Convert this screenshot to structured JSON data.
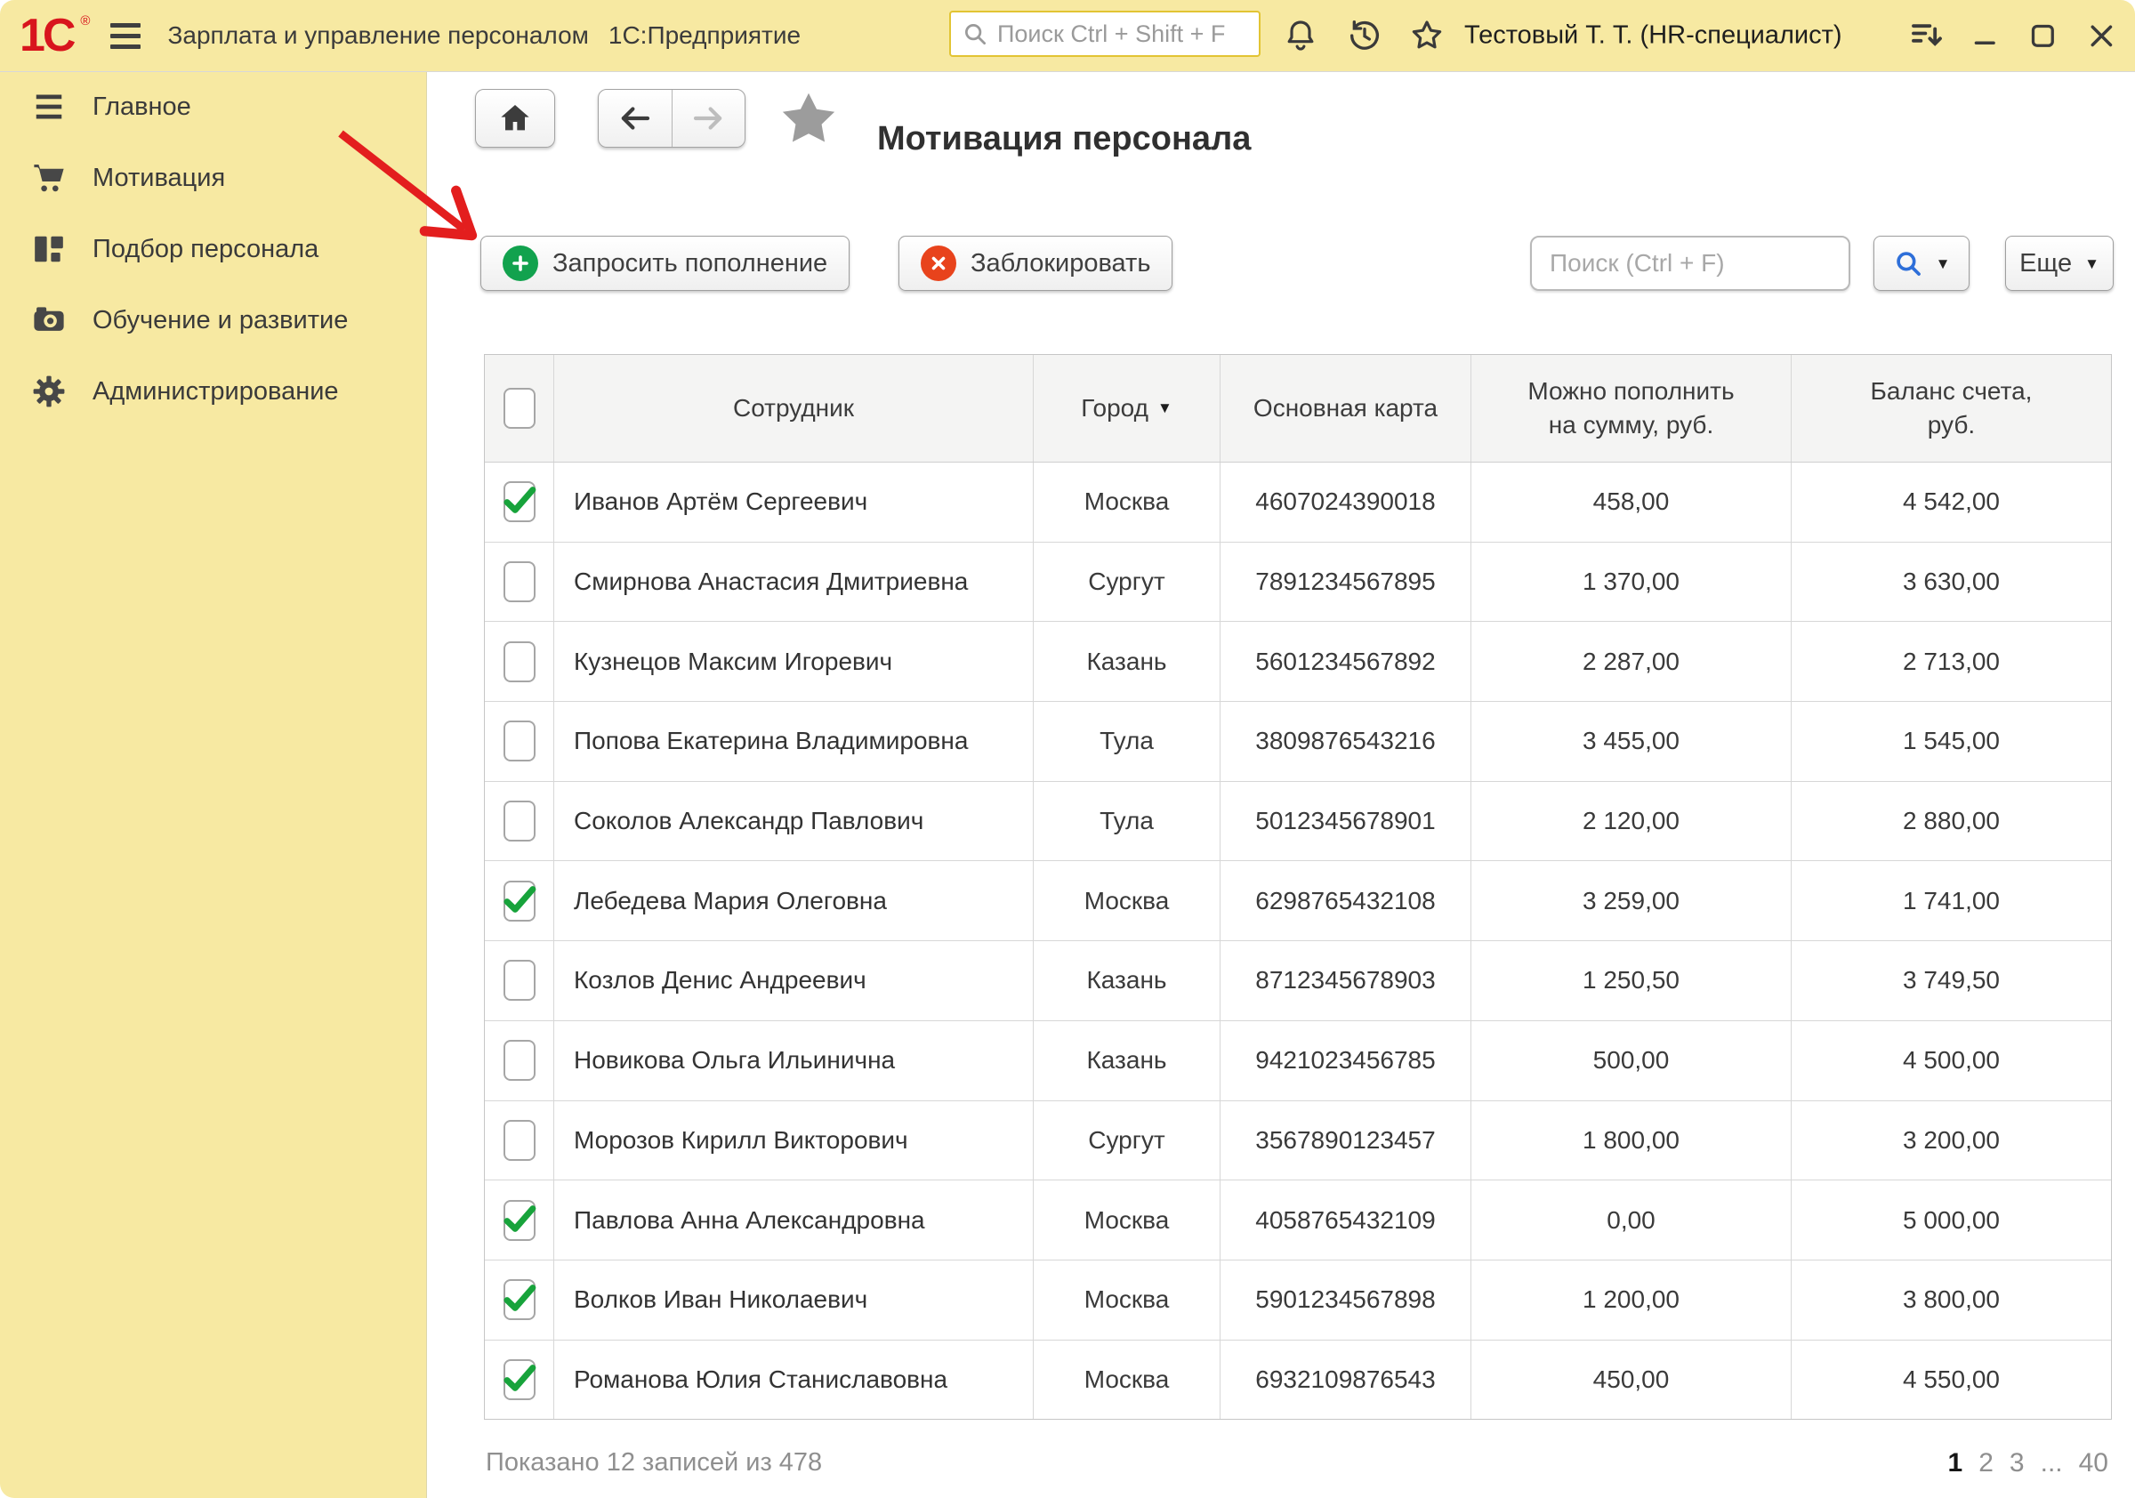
{
  "colors": {
    "chrome_yellow": "#F7E9A2",
    "brand_red": "#D8151D",
    "green_badge": "#12A24E",
    "red_badge": "#E8431C",
    "blue_search": "#2E6FD9",
    "arrow_red": "#E31E1E"
  },
  "topbar": {
    "brand": "1С",
    "registered": "®",
    "app_title": "Зарплата и управление персоналом",
    "platform": "1С:Предприятие",
    "search_placeholder": "Поиск Ctrl + Shift + F",
    "user": "Тестовый Т. Т. (HR-специалист)",
    "icons": [
      "bell-icon",
      "history-icon",
      "star-outline-icon",
      "collapse-panel-icon",
      "minimize-icon",
      "maximize-icon",
      "close-icon"
    ]
  },
  "sidebar": {
    "items": [
      {
        "id": "main",
        "icon": "menu-icon",
        "label": "Главное"
      },
      {
        "id": "motivation",
        "icon": "cart-icon",
        "label": "Мотивация"
      },
      {
        "id": "recruiting",
        "icon": "blocks-icon",
        "label": "Подбор персонала"
      },
      {
        "id": "training",
        "icon": "camera-icon",
        "label": "Обучение и развитие"
      },
      {
        "id": "administration",
        "icon": "gear-icon",
        "label": "Администрирование"
      }
    ]
  },
  "page": {
    "title": "Мотивация персонала"
  },
  "toolbar": {
    "request_label": "Запросить пополнение",
    "block_label": "Заблокировать",
    "search_placeholder": "Поиск (Ctrl + F)",
    "more_label": "Еще"
  },
  "table": {
    "columns": [
      {
        "id": "select",
        "label": "",
        "type": "checkbox"
      },
      {
        "id": "employee",
        "label": "Сотрудник"
      },
      {
        "id": "city",
        "label": "Город",
        "sorted": true
      },
      {
        "id": "card",
        "label": "Основная карта"
      },
      {
        "id": "amount",
        "label": "Можно пополнить\nна сумму, руб."
      },
      {
        "id": "balance",
        "label": "Баланс счета,\nруб."
      }
    ],
    "rows": [
      {
        "checked": true,
        "employee": "Иванов Артём Сергеевич",
        "city": "Москва",
        "card": "4607024390018",
        "amount": "458,00",
        "balance": "4 542,00"
      },
      {
        "checked": false,
        "employee": "Смирнова Анастасия Дмитриевна",
        "city": "Сургут",
        "card": "7891234567895",
        "amount": "1 370,00",
        "balance": "3 630,00"
      },
      {
        "checked": false,
        "employee": "Кузнецов Максим Игоревич",
        "city": "Казань",
        "card": "5601234567892",
        "amount": "2 287,00",
        "balance": "2 713,00"
      },
      {
        "checked": false,
        "employee": "Попова Екатерина Владимировна",
        "city": "Тула",
        "card": "3809876543216",
        "amount": "3 455,00",
        "balance": "1 545,00"
      },
      {
        "checked": false,
        "employee": "Соколов Александр Павлович",
        "city": "Тула",
        "card": "5012345678901",
        "amount": "2 120,00",
        "balance": "2 880,00"
      },
      {
        "checked": true,
        "employee": "Лебедева Мария Олеговна",
        "city": "Москва",
        "card": "6298765432108",
        "amount": "3 259,00",
        "balance": "1 741,00"
      },
      {
        "checked": false,
        "employee": "Козлов Денис Андреевич",
        "city": "Казань",
        "card": "8712345678903",
        "amount": "1 250,50",
        "balance": "3 749,50"
      },
      {
        "checked": false,
        "employee": "Новикова Ольга Ильинична",
        "city": "Казань",
        "card": "9421023456785",
        "amount": "500,00",
        "balance": "4 500,00"
      },
      {
        "checked": false,
        "employee": "Морозов Кирилл Викторович",
        "city": "Сургут",
        "card": "3567890123457",
        "amount": "1 800,00",
        "balance": "3 200,00"
      },
      {
        "checked": true,
        "employee": "Павлова Анна Александровна",
        "city": "Москва",
        "card": "4058765432109",
        "amount": "0,00",
        "balance": "5 000,00"
      },
      {
        "checked": true,
        "employee": "Волков Иван Николаевич",
        "city": "Москва",
        "card": "5901234567898",
        "amount": "1 200,00",
        "balance": "3 800,00"
      },
      {
        "checked": true,
        "employee": "Романова Юлия Станиславовна",
        "city": "Москва",
        "card": "6932109876543",
        "amount": "450,00",
        "balance": "4 550,00"
      }
    ]
  },
  "footer": {
    "summary": "Показано 12 записей из 478",
    "pages": [
      "1",
      "2",
      "3",
      "...",
      "40"
    ],
    "current_page": "1"
  }
}
